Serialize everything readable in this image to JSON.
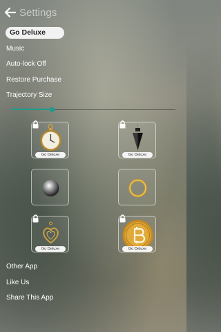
{
  "header": {
    "title": "Settings"
  },
  "menu": {
    "go_deluxe": "Go Deluxe",
    "music": "Music",
    "auto_lock": "Auto-lock Off",
    "restore_purchase": "Restore Purchase",
    "trajectory_size": "Trajectory Size"
  },
  "trajectory_slider": {
    "value_percent": 25
  },
  "accent_color": "#1e9c8e",
  "pendulums": [
    {
      "name": "pocket-watch",
      "locked": true,
      "badge": "Go Deluxe"
    },
    {
      "name": "crystal-pendulum",
      "locked": true,
      "badge": "Go Deluxe"
    },
    {
      "name": "silver-ball",
      "locked": false
    },
    {
      "name": "gold-ring",
      "locked": false
    },
    {
      "name": "heart-pendant",
      "locked": true,
      "badge": "Go Deluxe"
    },
    {
      "name": "bitcoin-coin",
      "locked": true,
      "badge": "Go Deluxe"
    }
  ],
  "footer": {
    "other_app": "Other App",
    "like_us": "Like Us",
    "share": "Share This App"
  }
}
